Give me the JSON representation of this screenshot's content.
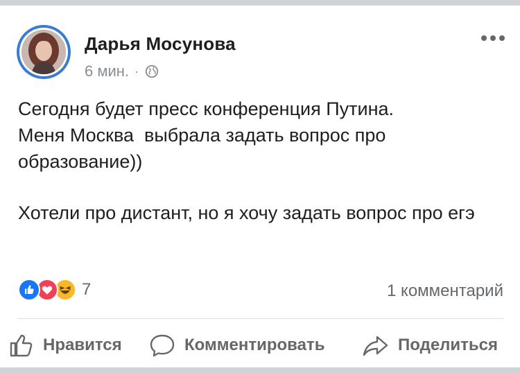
{
  "post": {
    "author": "Дарья Мосунова",
    "time": "6 мин.",
    "separator": "·",
    "privacy_icon": "globe-icon",
    "paragraphs": [
      "Сегодня будет пресс конференция Путина.\nМеня Москва  выбрала задать вопрос про образование))",
      "Хотели про дистант, но я хочу задать вопрос про егэ"
    ]
  },
  "reactions": {
    "icons": [
      "like-icon",
      "love-icon",
      "haha-icon"
    ],
    "count": "7"
  },
  "comments": {
    "count_label": "1 комментарий"
  },
  "actions": {
    "like": "Нравится",
    "comment": "Комментировать",
    "share": "Поделиться"
  },
  "colors": {
    "accent": "#1877f2",
    "love": "#f33e58",
    "haha": "#f7b928",
    "secondary_text": "#65676b"
  }
}
